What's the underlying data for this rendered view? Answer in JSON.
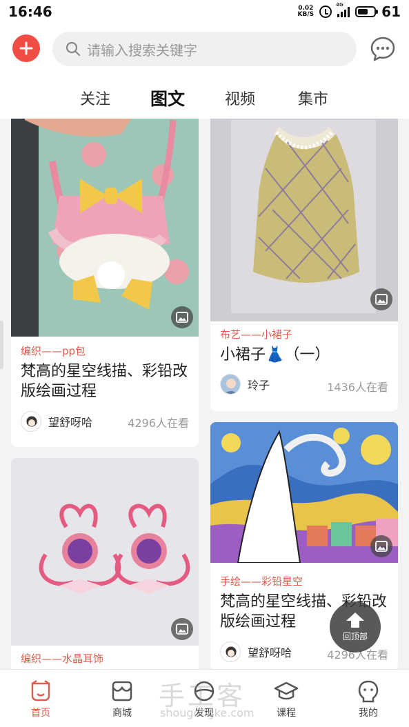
{
  "status_bar": {
    "time": "16:46",
    "net_speed": "0.02",
    "net_unit": "KB/S",
    "signal_label": "4G",
    "battery": "61"
  },
  "header": {
    "search_placeholder": "请输入搜索关键字",
    "tabs": [
      {
        "label": "关注",
        "active": false
      },
      {
        "label": "图文",
        "active": true
      },
      {
        "label": "视频",
        "active": false
      },
      {
        "label": "集市",
        "active": false
      }
    ]
  },
  "feed": {
    "cards": [
      {
        "category": "编织——pp包",
        "title": "梵高的星空线描、彩铅改版绘画过程",
        "author": "望舒呀哈",
        "views": "4296人在看"
      },
      {
        "category": "布艺——小裙子",
        "title": "小裙子👗（一）",
        "author": "玲子",
        "views": "1436人在看"
      },
      {
        "category": "编织——水晶耳饰",
        "title": "",
        "author": "",
        "views": ""
      },
      {
        "category": "手绘——彩铅星空",
        "title": "梵高的星空线描、彩铅改版绘画过程",
        "author": "望舒呀哈",
        "views": "4296人在看"
      }
    ]
  },
  "back_to_top": {
    "label": "回顶部"
  },
  "watermark": {
    "brand": "手工客",
    "site": "shougongke.com"
  },
  "bottom_nav": [
    {
      "label": "首页",
      "icon": "home-icon",
      "active": true
    },
    {
      "label": "商城",
      "icon": "shop-icon",
      "active": false
    },
    {
      "label": "发现",
      "icon": "discover-icon",
      "active": false
    },
    {
      "label": "课程",
      "icon": "course-icon",
      "active": false
    },
    {
      "label": "我的",
      "icon": "profile-icon",
      "active": false
    }
  ],
  "colors": {
    "accent": "#e25a4b",
    "plus": "#f04e45"
  }
}
